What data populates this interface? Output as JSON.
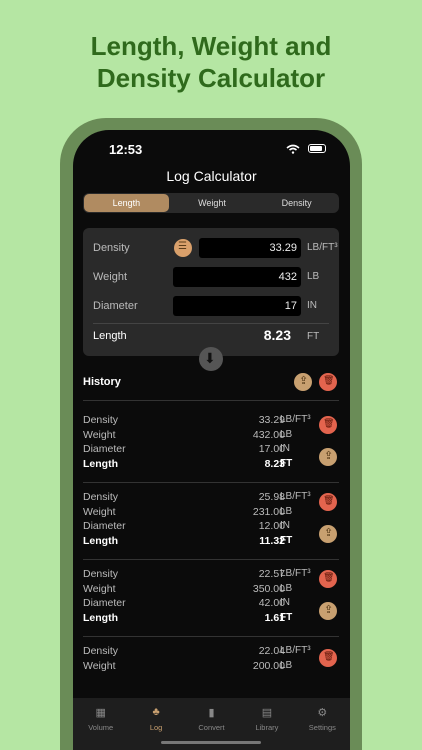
{
  "headline": {
    "line1": "Length, Weight and",
    "line2": "Density Calculator"
  },
  "status": {
    "time": "12:53"
  },
  "nav": {
    "title": "Log Calculator"
  },
  "segments": [
    "Length",
    "Weight",
    "Density"
  ],
  "inputs": {
    "density": {
      "label": "Density",
      "value": "33.29",
      "unit": "LB/FT³"
    },
    "weight": {
      "label": "Weight",
      "value": "432",
      "unit": "LB"
    },
    "diameter": {
      "label": "Diameter",
      "value": "17",
      "unit": "IN"
    },
    "length": {
      "label": "Length",
      "value": "8.23",
      "unit": "FT"
    }
  },
  "history": {
    "title": "History",
    "entries": [
      {
        "density": "33.29",
        "weight": "432.00",
        "diameter": "17.00",
        "length": "8.23"
      },
      {
        "density": "25.98",
        "weight": "231.00",
        "diameter": "12.00",
        "length": "11.32"
      },
      {
        "density": "22.57",
        "weight": "350.00",
        "diameter": "42.00",
        "length": "1.61"
      },
      {
        "density": "22.04",
        "weight": "200.00",
        "diameter": "",
        "length": ""
      }
    ],
    "labels": {
      "density": "Density",
      "weight": "Weight",
      "diameter": "Diameter",
      "length": "Length"
    },
    "units": {
      "density": "LB/FT³",
      "weight": "LB",
      "diameter": "IN",
      "length": "FT"
    }
  },
  "tabs": [
    {
      "label": "Volume",
      "icon": "grid-icon"
    },
    {
      "label": "Log",
      "icon": "tree-icon"
    },
    {
      "label": "Convert",
      "icon": "book-icon"
    },
    {
      "label": "Library",
      "icon": "library-icon"
    },
    {
      "label": "Settings",
      "icon": "gear-icon"
    }
  ]
}
